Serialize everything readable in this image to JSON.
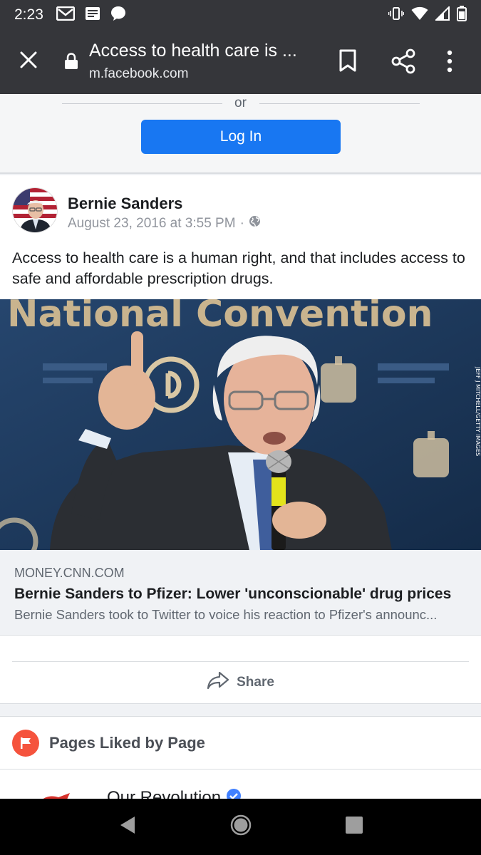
{
  "status_bar": {
    "time": "2:23"
  },
  "browser": {
    "page_title": "Access to health care is ...",
    "url": "m.facebook.com"
  },
  "login": {
    "or_text": "or",
    "login_label": "Log In"
  },
  "post": {
    "author": "Bernie Sanders",
    "timestamp": "August 23, 2016 at 3:55 PM",
    "separator": "·",
    "text": "Access to health care is a human right, and that includes access to safe and affordable prescription drugs.",
    "image_banner": "National Convention",
    "link": {
      "source": "MONEY.CNN.COM",
      "title": "Bernie Sanders to Pfizer: Lower 'unconscionable' drug prices",
      "description": "Bernie Sanders took to Twitter to voice his reaction to Pfizer's announc..."
    },
    "share_label": "Share"
  },
  "pages_liked": {
    "title": "Pages Liked by Page",
    "first_page": "Our Revolution"
  },
  "colors": {
    "facebook_blue": "#1877f2",
    "toolbar": "#35363a",
    "pages_flag": "#f5533d"
  },
  "icons": [
    "gmail-icon",
    "news-icon",
    "chat-icon",
    "vibrate-icon",
    "wifi-icon",
    "signal-icon",
    "battery-icon",
    "close-icon",
    "lock-icon",
    "bookmark-icon",
    "share-icon",
    "more-vert-icon",
    "globe-icon",
    "share-arrow-icon",
    "flag-icon",
    "back-icon",
    "home-icon",
    "recents-icon"
  ]
}
